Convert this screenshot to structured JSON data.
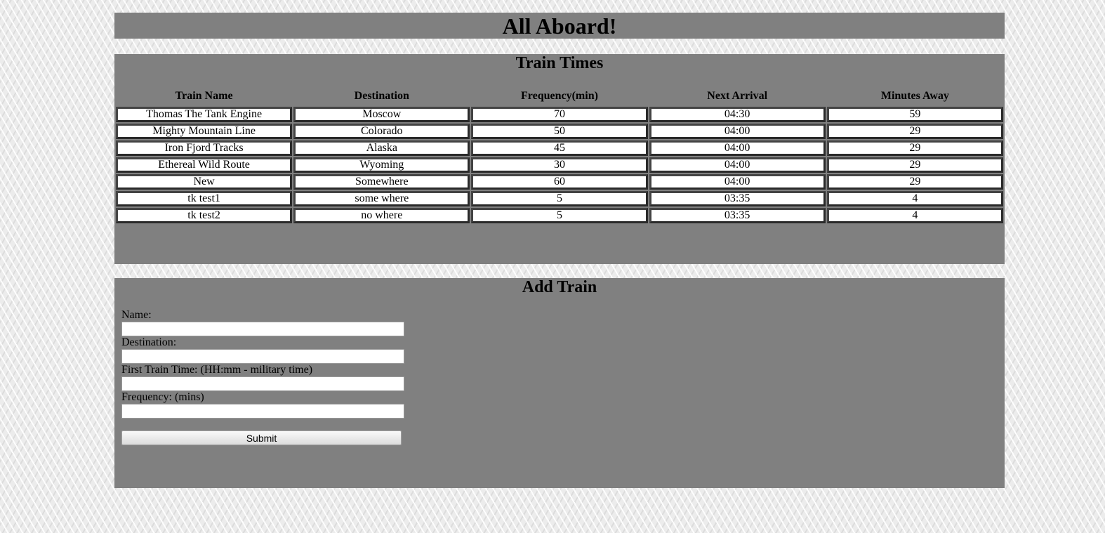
{
  "header": {
    "title": "All Aboard!"
  },
  "train_times": {
    "heading": "Train Times",
    "columns": [
      "Train Name",
      "Destination",
      "Frequency(min)",
      "Next Arrival",
      "Minutes Away"
    ],
    "rows": [
      [
        "Thomas The Tank Engine",
        "Moscow",
        "70",
        "04:30",
        "59"
      ],
      [
        "Mighty Mountain Line",
        "Colorado",
        "50",
        "04:00",
        "29"
      ],
      [
        "Iron Fjord Tracks",
        "Alaska",
        "45",
        "04:00",
        "29"
      ],
      [
        "Ethereal Wild Route",
        "Wyoming",
        "30",
        "04:00",
        "29"
      ],
      [
        "New",
        "Somewhere",
        "60",
        "04:00",
        "29"
      ],
      [
        "tk test1",
        "some where",
        "5",
        "03:35",
        "4"
      ],
      [
        "tk test2",
        "no where",
        "5",
        "03:35",
        "4"
      ]
    ]
  },
  "add_train": {
    "heading": "Add Train",
    "name_label": "Name:",
    "name_value": "",
    "destination_label": "Destination:",
    "destination_value": "",
    "first_time_label": "First Train Time: (HH:mm - military time)",
    "first_time_value": "",
    "frequency_label": "Frequency: (mins)",
    "frequency_value": "",
    "submit_label": "Submit"
  }
}
